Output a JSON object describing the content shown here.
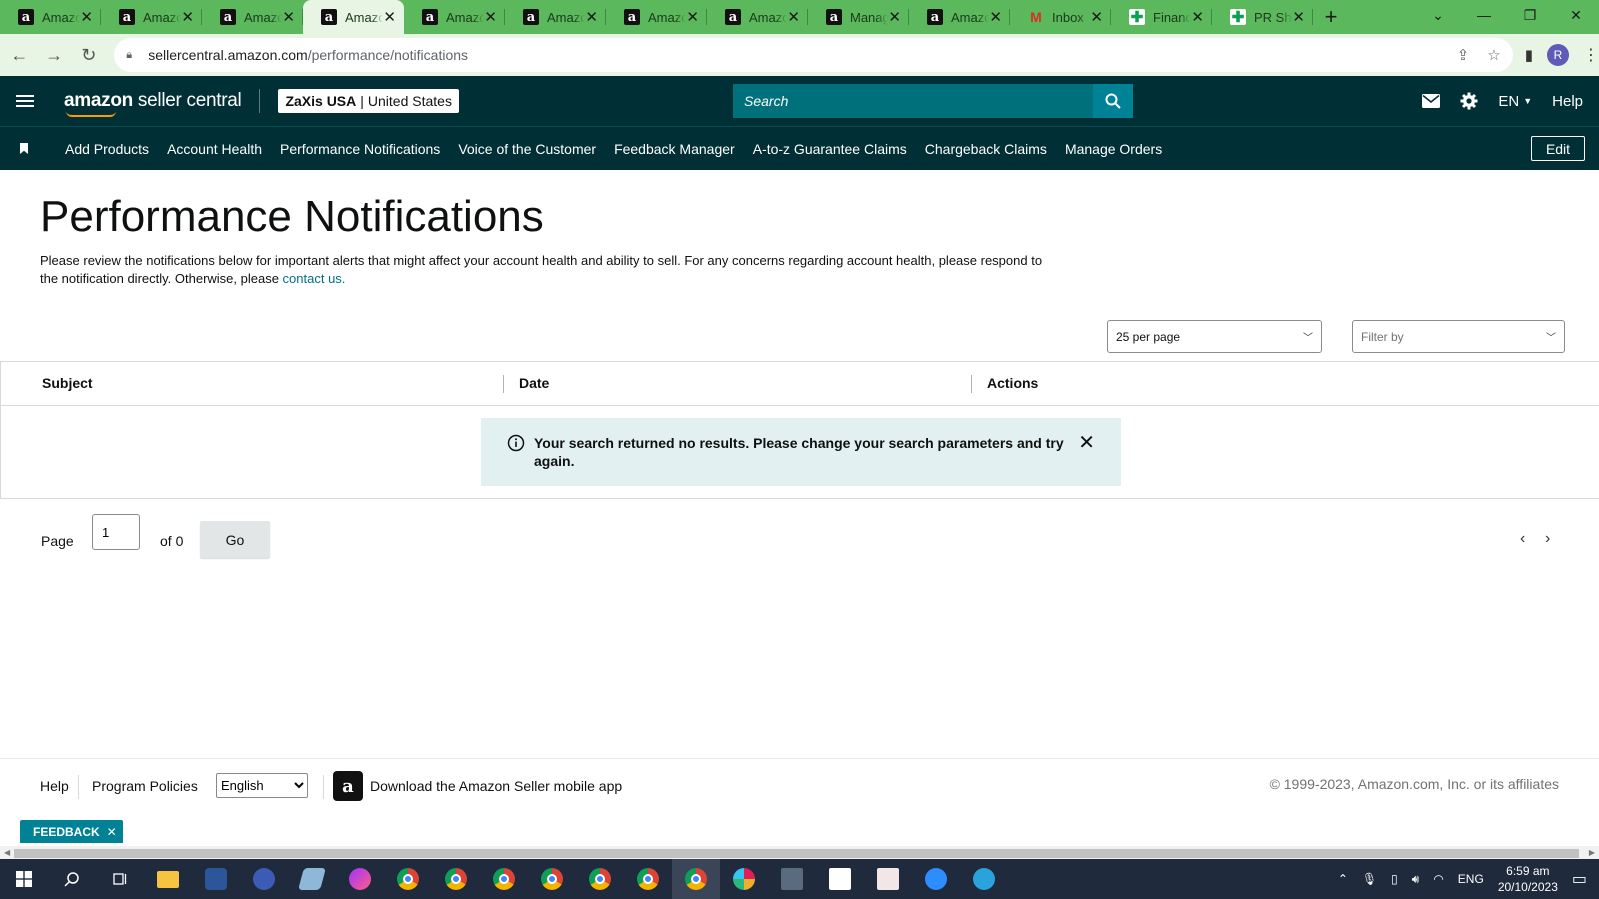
{
  "browser": {
    "tabs": [
      {
        "label": "Amazon",
        "icon": "amazon-icon",
        "active": false
      },
      {
        "label": "Amazon",
        "icon": "amazon-icon",
        "active": false
      },
      {
        "label": "Amazon",
        "icon": "amazon-icon",
        "active": false
      },
      {
        "label": "Amazon",
        "icon": "amazon-icon",
        "active": true
      },
      {
        "label": "Amazon",
        "icon": "amazon-icon",
        "active": false
      },
      {
        "label": "Amazon",
        "icon": "amazon-icon",
        "active": false
      },
      {
        "label": "Amazon",
        "icon": "amazon-icon",
        "active": false
      },
      {
        "label": "Amazon",
        "icon": "amazon-icon",
        "active": false
      },
      {
        "label": "Manage",
        "icon": "amazon-icon",
        "active": false
      },
      {
        "label": "Amazon",
        "icon": "amazon-icon",
        "active": false
      },
      {
        "label": "Inbox",
        "icon": "gmail-icon",
        "active": false
      },
      {
        "label": "Finance",
        "icon": "sheets-icon",
        "active": false
      },
      {
        "label": "PR Sh",
        "icon": "sheets-icon",
        "active": false
      }
    ],
    "url_host": "sellercentral.amazon.com",
    "url_path": "/performance/notifications",
    "profile_initial": "R",
    "tab_color": "#5cb85c"
  },
  "header": {
    "logo_bold": "amazon",
    "logo_rest": " seller central",
    "account_name": "ZaXis USA",
    "account_sep": "|",
    "account_region": "United States",
    "search_placeholder": "Search",
    "lang": "EN",
    "help": "Help"
  },
  "nav": {
    "items": [
      "Add Products",
      "Account Health",
      "Performance Notifications",
      "Voice of the Customer",
      "Feedback Manager",
      "A-to-z Guarantee Claims",
      "Chargeback Claims",
      "Manage Orders"
    ],
    "edit": "Edit"
  },
  "page": {
    "title": "Performance Notifications",
    "desc": "Please review the notifications below for important alerts that might affect your account health and ability to sell. For any concerns regarding account health, please respond to the notification directly. Otherwise, please ",
    "contact_link": "contact us.",
    "per_page": "25 per page",
    "filter_by": "Filter by"
  },
  "table": {
    "columns": [
      "Subject",
      "Date",
      "Actions"
    ],
    "empty_message": "Your search returned no results. Please change your search parameters and try again."
  },
  "pager": {
    "label": "Page",
    "current": "1",
    "of": "of 0",
    "go": "Go"
  },
  "footer": {
    "help": "Help",
    "policies": "Program Policies",
    "language": "English",
    "app_text": "Download the Amazon Seller mobile app",
    "copyright": "© 1999-2023, Amazon.com, Inc. or its affiliates"
  },
  "feedback": "FEEDBACK",
  "taskbar": {
    "time": "6:59 am",
    "date": "20/10/2023",
    "lang": "ENG"
  },
  "colors": {
    "header_bg": "#002f36",
    "search_bg": "#00707b",
    "link": "#007185",
    "alert_bg": "#e3f0f1"
  }
}
